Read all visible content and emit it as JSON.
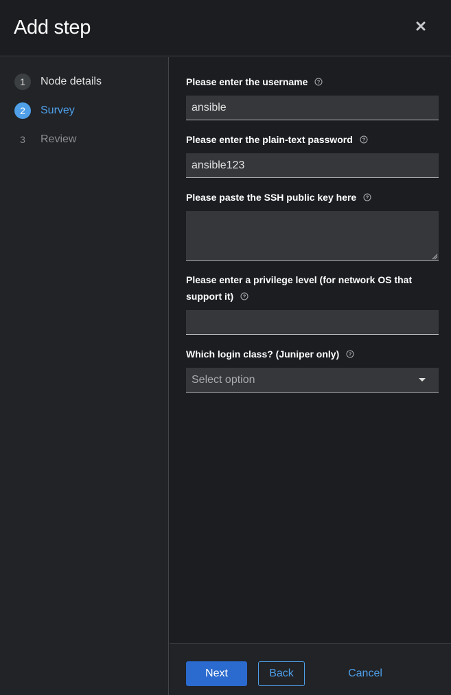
{
  "header": {
    "title": "Add step",
    "close_icon": "close-icon"
  },
  "wizard_nav": {
    "items": [
      {
        "number": "1",
        "label": "Node details",
        "state": "done"
      },
      {
        "number": "2",
        "label": "Survey",
        "state": "current"
      },
      {
        "number": "3",
        "label": "Review",
        "state": "pending"
      }
    ]
  },
  "form": {
    "username": {
      "label": "Please enter the username",
      "value": "ansible",
      "help_icon": "help-icon"
    },
    "password": {
      "label": "Please enter the plain-text password",
      "value": "ansible123",
      "help_icon": "help-icon"
    },
    "ssh_key": {
      "label": "Please paste the SSH public key here",
      "value": "",
      "help_icon": "help-icon"
    },
    "privilege": {
      "label": "Please enter a privilege level (for network OS that support it)",
      "value": "",
      "help_icon": "help-icon"
    },
    "login_class": {
      "label": "Which login class? (Juniper only)",
      "placeholder": "Select option",
      "help_icon": "help-icon"
    }
  },
  "footer": {
    "next_label": "Next",
    "back_label": "Back",
    "cancel_label": "Cancel"
  },
  "colors": {
    "accent": "#4f9fe9",
    "primary_button": "#2b6ace",
    "background": "#1b1d21",
    "sidebar": "#212327",
    "input": "#36373b"
  }
}
